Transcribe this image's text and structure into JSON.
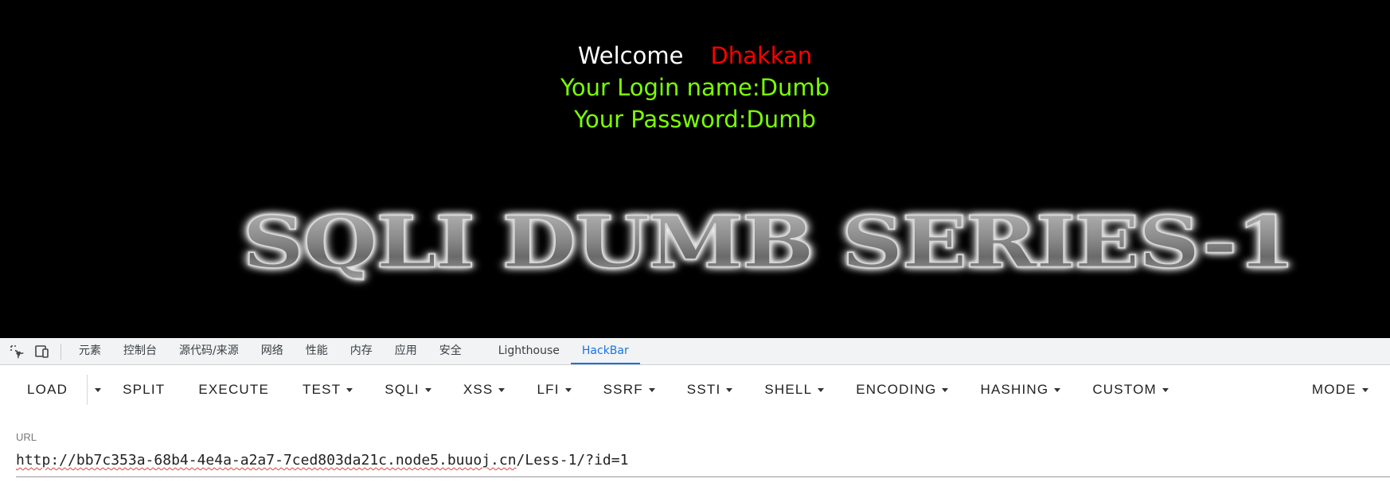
{
  "page": {
    "welcome": "Welcome",
    "username_display": "Dhakkan",
    "login_line": "Your Login name:Dumb",
    "password_line": "Your Password:Dumb",
    "banner": "SQLI DUMB SERIES-1",
    "colors": {
      "welcome": "#ffffff",
      "username": "#ff0000",
      "info": "#7cff00",
      "background": "#000000"
    }
  },
  "devtools": {
    "icons": [
      "inspect-element-icon",
      "device-toolbar-icon"
    ],
    "tabs": [
      {
        "label": "元素"
      },
      {
        "label": "控制台"
      },
      {
        "label": "源代码/来源"
      },
      {
        "label": "网络"
      },
      {
        "label": "性能"
      },
      {
        "label": "内存"
      },
      {
        "label": "应用"
      },
      {
        "label": "安全"
      },
      {
        "label": "Lighthouse"
      },
      {
        "label": "HackBar",
        "active": true
      }
    ],
    "accent": "#1a73e8"
  },
  "hackbar": {
    "buttons": {
      "load": "LOAD",
      "split": "SPLIT",
      "execute": "EXECUTE",
      "test": "TEST",
      "sqli": "SQLI",
      "xss": "XSS",
      "lfi": "LFI",
      "ssrf": "SSRF",
      "ssti": "SSTI",
      "shell": "SHELL",
      "encoding": "ENCODING",
      "hashing": "HASHING",
      "custom": "CUSTOM",
      "mode": "MODE"
    },
    "url_label": "URL",
    "url": {
      "scheme": "http://",
      "host": "bb7c353a-68b4-4e4a-a2a7-7ced803da21c.node5.buuoj.cn",
      "path": "/Less-1/?id=1"
    }
  }
}
